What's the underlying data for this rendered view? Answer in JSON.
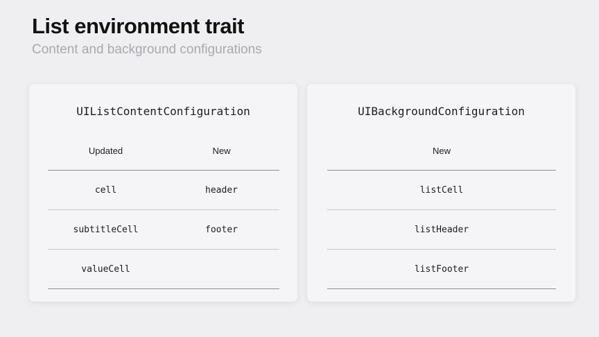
{
  "header": {
    "title": "List environment trait",
    "subtitle": "Content and background configurations"
  },
  "left_card": {
    "title": "UIListContentConfiguration",
    "columns": [
      "Updated",
      "New"
    ],
    "rows": [
      [
        "cell",
        "header"
      ],
      [
        "subtitleCell",
        "footer"
      ],
      [
        "valueCell",
        ""
      ]
    ]
  },
  "right_card": {
    "title": "UIBackgroundConfiguration",
    "columns": [
      "New"
    ],
    "rows": [
      [
        "listCell"
      ],
      [
        "listHeader"
      ],
      [
        "listFooter"
      ]
    ]
  }
}
